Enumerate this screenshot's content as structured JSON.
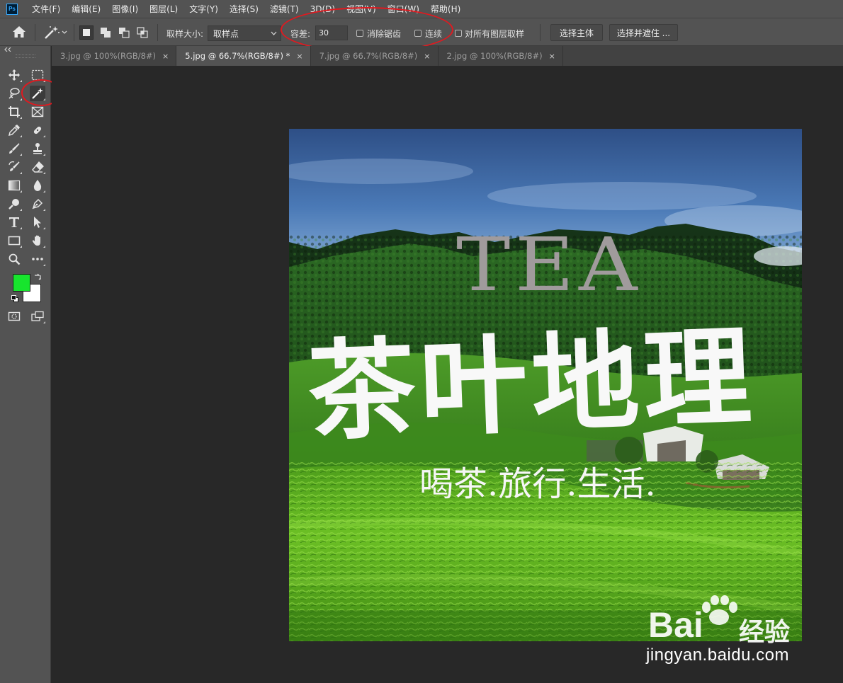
{
  "app": {
    "logo_text": "Ps"
  },
  "menu": [
    "文件(F)",
    "编辑(E)",
    "图像(I)",
    "图层(L)",
    "文字(Y)",
    "选择(S)",
    "滤镜(T)",
    "3D(D)",
    "视图(V)",
    "窗口(W)",
    "帮助(H)"
  ],
  "options": {
    "sample_size_label": "取样大小:",
    "sample_size_value": "取样点",
    "tolerance_label": "容差:",
    "tolerance_value": "30",
    "antialias_label": "消除锯齿",
    "contiguous_label": "连续",
    "sample_all_layers_label": "对所有图层取样",
    "select_subject_label": "选择主体",
    "select_and_mask_label": "选择并遮住 ..."
  },
  "tabs": [
    {
      "label": "3.jpg @ 100%(RGB/8#)",
      "active": false
    },
    {
      "label": "5.jpg @ 66.7%(RGB/8#) *",
      "active": true
    },
    {
      "label": "7.jpg @ 66.7%(RGB/8#)",
      "active": false
    },
    {
      "label": "2.jpg @ 100%(RGB/8#)",
      "active": false
    }
  ],
  "tab_close_glyph": "×",
  "colors": {
    "foreground": "#17e52d",
    "background": "#ffffff",
    "annotation_red": "#e1191f",
    "panel": "#535353",
    "canvas_bg": "#282828"
  },
  "image": {
    "title_en": "TEA",
    "title_cn": "茶叶地理",
    "subtitle": "喝茶.旅行.生活."
  },
  "watermark": {
    "brand_left": "Bai",
    "brand_right": "经验",
    "url": "jingyan.baidu.com"
  }
}
